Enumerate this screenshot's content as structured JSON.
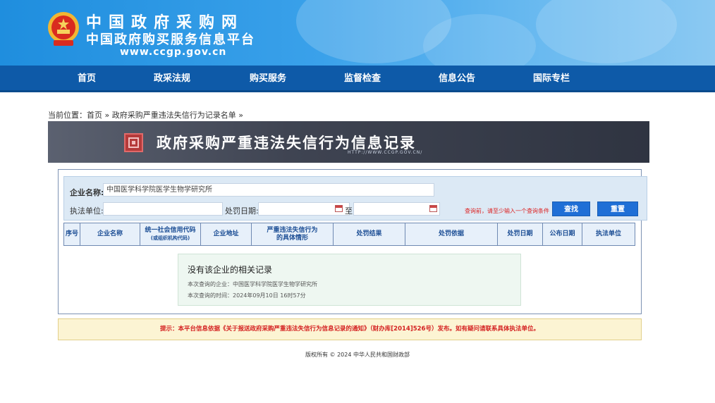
{
  "header": {
    "site_name": "中国政府采购网",
    "site_subtitle": "中国政府购买服务信息平台",
    "site_url": "www.ccgp.gov.cn"
  },
  "nav": {
    "items": [
      {
        "label": "首页"
      },
      {
        "label": "政采法规"
      },
      {
        "label": "购买服务"
      },
      {
        "label": "监督检查"
      },
      {
        "label": "信息公告"
      },
      {
        "label": "国际专栏"
      }
    ]
  },
  "breadcrumb": {
    "prefix": "当前位置：",
    "home": "首页",
    "sep1": " » ",
    "current": "政府采购严重违法失信行为记录名单",
    "sep2": " »"
  },
  "page_title": {
    "text": "政府采购严重违法失信行为信息记录",
    "url_caption": "HTTP://WWW.CCGP.GOV.CN/"
  },
  "search": {
    "company_label": "企业名称:",
    "company_value": "中国医学科学院医学生物学研究所",
    "agency_label": "执法单位:",
    "agency_value": "",
    "date_label": "处罚日期:",
    "date_from": "",
    "to_label": "至",
    "date_to": "",
    "hint": "查询前，请至少输入一个查询条件",
    "search_button": "查找",
    "reset_button": "重置"
  },
  "table": {
    "headers": [
      {
        "line1": "序号",
        "line2": ""
      },
      {
        "line1": "企业名称",
        "line2": ""
      },
      {
        "line1": "统一社会信用代码",
        "line2": "(或组织机构代码)"
      },
      {
        "line1": "企业地址",
        "line2": ""
      },
      {
        "line1": "严重违法失信行为",
        "line2": "的具体情形"
      },
      {
        "line1": "处罚结果",
        "line2": ""
      },
      {
        "line1": "处罚依据",
        "line2": ""
      },
      {
        "line1": "处罚日期",
        "line2": ""
      },
      {
        "line1": "公布日期",
        "line2": ""
      },
      {
        "line1": "执法单位",
        "line2": ""
      }
    ]
  },
  "result": {
    "message": "没有该企业的相关记录",
    "query_company": "本次查询的企业：中国医学科学院医学生物学研究所",
    "query_time": "本次查询的时间：2024年09月10日 16时57分"
  },
  "notice": {
    "text": "提示：本平台信息依据《关于报送政府采购严重违法失信行为信息记录的通知》（财办库[2014]526号）发布。如有疑问请联系具体执法单位。"
  },
  "footer": {
    "copyright": "版权所有 © 2024 中华人民共和国财政部"
  },
  "colors": {
    "nav_bg": "#0e5aa8",
    "banner_blue": "#2a93e0",
    "title_bar": "#3f4452",
    "button_blue": "#1f6fd6",
    "notice_red": "#d42020",
    "notice_bg": "#fcf4d3"
  }
}
